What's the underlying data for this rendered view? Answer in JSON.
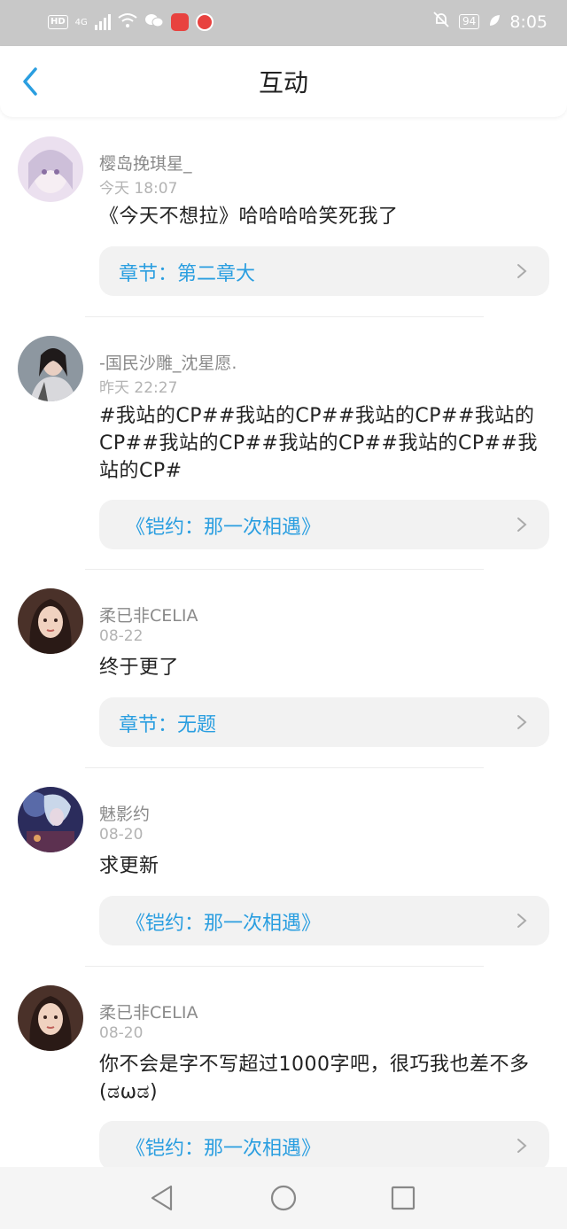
{
  "status_bar": {
    "hd": "HD",
    "net": "4G",
    "battery": "94",
    "time": "8:05"
  },
  "header": {
    "title": "互动"
  },
  "items": [
    {
      "username": "樱岛挽琪星_",
      "time": "今天 18:07",
      "content": "《今天不想拉》哈哈哈哈笑死我了",
      "link": "章节：第二章大",
      "avatar_color": "#e7d7ea"
    },
    {
      "username": "-国民沙雕_沈星愿.",
      "time": "昨天 22:27",
      "content": "#我站的CP##我站的CP##我站的CP##我站的CP##我站的CP##我站的CP##我站的CP##我站的CP#",
      "link": "《铠约：那一次相遇》",
      "avatar_color": "#6f7b86"
    },
    {
      "username": "柔已非CELIA",
      "time": "08-22",
      "content": "终于更了",
      "link": "章节：无题",
      "avatar_color": "#3a2a25"
    },
    {
      "username": "魅影约",
      "time": "08-20",
      "content": "求更新",
      "link": "《铠约：那一次相遇》",
      "avatar_color": "#2d2f5a"
    },
    {
      "username": "柔已非CELIA",
      "time": "08-20",
      "content": "你不会是字不写超过1000字吧，很巧我也差不多(ಡωಡ)",
      "link": "《铠约：那一次相遇》",
      "avatar_color": "#3a2a25"
    }
  ],
  "colors": {
    "link": "#2a9ee0",
    "accent": "#2a9ee0"
  }
}
